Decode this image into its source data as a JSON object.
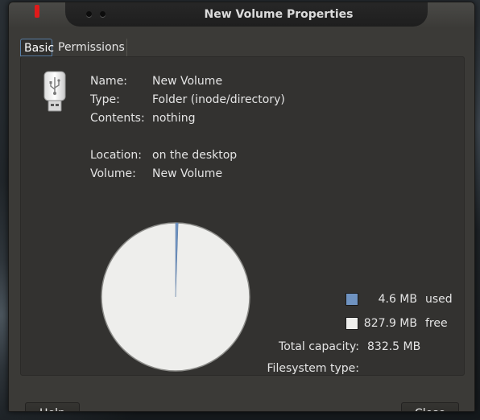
{
  "window": {
    "title": "New Volume Properties"
  },
  "tabs": [
    {
      "label": "Basic",
      "active": true
    },
    {
      "label": "Permissions",
      "active": false
    }
  ],
  "info": {
    "icon": "usb-drive-icon",
    "rows": [
      {
        "label": "Name:",
        "value": "New Volume"
      },
      {
        "label": "Type:",
        "value": "Folder (inode/directory)"
      },
      {
        "label": "Contents:",
        "value": "nothing"
      },
      {
        "label": "Location:",
        "value": "on the desktop"
      },
      {
        "label": "Volume:",
        "value": "New Volume"
      }
    ]
  },
  "usage": {
    "used": {
      "amount": "4.6 MB",
      "label": "used",
      "color": "#6f93c1",
      "fraction": 0.0055
    },
    "free": {
      "amount": "827.9 MB",
      "label": "free",
      "color": "#eeeeec",
      "fraction": 0.9945
    },
    "total_label": "Total capacity:",
    "total_value": "832.5 MB",
    "fs_label": "Filesystem type:",
    "fs_value": ""
  },
  "buttons": {
    "help": "Help",
    "close": "Close"
  }
}
